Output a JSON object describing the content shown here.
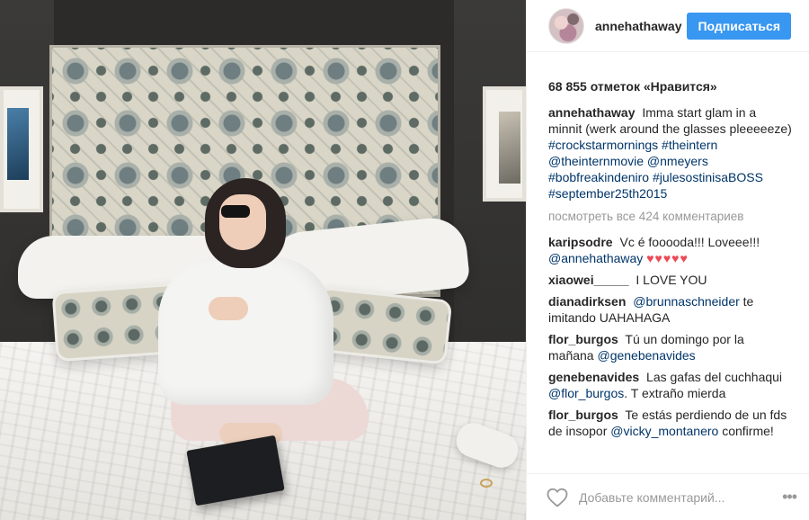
{
  "post": {
    "username": "annehathaway",
    "follow_label": "Подписаться",
    "likes": "68 855 отметок «Нравится»",
    "caption": {
      "user": "annehathaway",
      "text": "Imma start glam in a minnit (werk around the glasses pleeeeeze)",
      "tags": "#crockstarmornings #theintern @theinternmovie @nmeyers #bobfreakindeniro #julesostinisaBOSS #september25th2015"
    },
    "view_all": "посмотреть все 424 комментариев",
    "comments": [
      {
        "user": "karipsodre",
        "text": "Vc é fooooda!!! Loveee!!!",
        "mention": "@annehathaway",
        "hearts": "♥♥♥♥♥",
        "after": ""
      },
      {
        "user": "xiaowei_____",
        "text": "I LOVE YOU",
        "mention": "",
        "hearts": "",
        "after": ""
      },
      {
        "user": "dianadirksen",
        "text": "",
        "mention": "@brunnaschneider",
        "hearts": "",
        "after": "te imitando UAHAHAGA"
      },
      {
        "user": "flor_burgos",
        "text": "Tú un domingo por la mañana",
        "mention": "@genebenavides",
        "hearts": "",
        "after": ""
      },
      {
        "user": "genebenavides",
        "text": "Las gafas del cuchhaqui",
        "mention": "@flor_burgos",
        "hearts": "",
        "after": ". T extraño mierda"
      },
      {
        "user": "flor_burgos",
        "text": "Te estás perdiendo de un fds de insopor",
        "mention": "@vicky_montanero",
        "hearts": "",
        "after": "confirme!"
      }
    ],
    "add_comment_placeholder": "Добавьте комментарий...",
    "more_label": "•••"
  },
  "colors": {
    "accent": "#3897f0",
    "link": "#003569",
    "heart": "#ed4956"
  },
  "icons": {
    "like": "heart-outline-icon",
    "more": "ellipsis-icon"
  }
}
